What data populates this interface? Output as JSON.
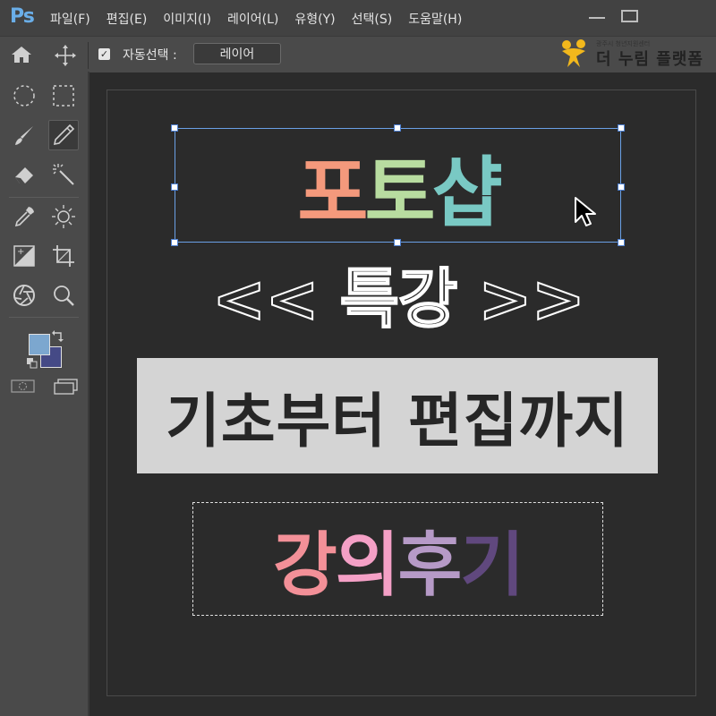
{
  "app": {
    "logo": "Ps",
    "menu": [
      "파일(F)",
      "편집(E)",
      "이미지(I)",
      "레이어(L)",
      "유형(Y)",
      "선택(S)",
      "도움말(H)"
    ]
  },
  "options_bar": {
    "auto_select_checked": true,
    "auto_select_label": "자동선택 :",
    "select_value": "레이어"
  },
  "brand": {
    "subtitle": "광주시 청년지원센터",
    "name": "더 누림 플랫폼"
  },
  "toolbar": {
    "tools": [
      "home-icon",
      "move-icon",
      "ellipse-marquee-icon",
      "rect-marquee-icon",
      "brush-icon",
      "pencil-icon",
      "eraser-icon",
      "magic-wand-icon",
      "eyedropper-icon",
      "brightness-icon",
      "gradient-icon",
      "crop-icon",
      "aperture-icon",
      "zoom-icon"
    ],
    "foreground_color": "#7ca7cf",
    "background_color": "#454a86"
  },
  "canvas": {
    "title_chars": [
      {
        "ch": "포",
        "color": "#f4997c"
      },
      {
        "ch": "토",
        "color": "#b8dca0"
      },
      {
        "ch": "샵",
        "color": "#79c9c4"
      }
    ],
    "subtitle": "<< 특강 >>",
    "banner": "기초부터 편집까지",
    "review_chars": [
      {
        "ch": "강",
        "color": "#f39098"
      },
      {
        "ch": "의",
        "color": "#f4a0c6"
      },
      {
        "ch": "후",
        "color": "#b69ac7"
      },
      {
        "ch": "기",
        "color": "#60487e"
      }
    ]
  }
}
